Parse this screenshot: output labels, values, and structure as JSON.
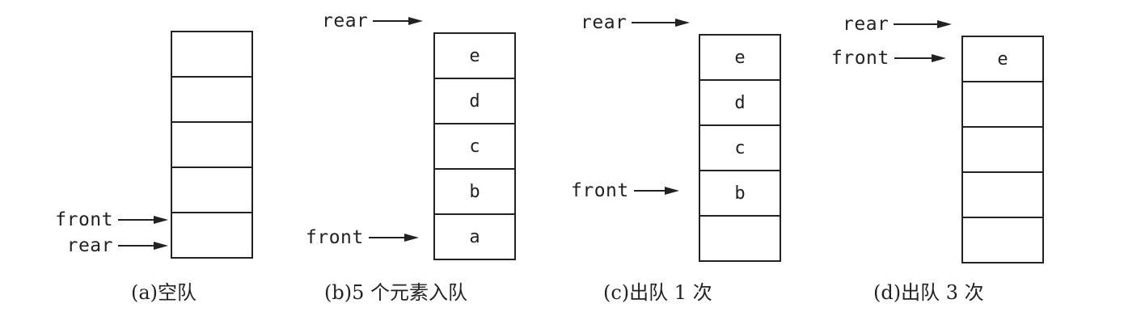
{
  "panels": [
    {
      "caption": "(a)空队",
      "cells": [
        "",
        "",
        "",
        "",
        ""
      ],
      "pointers": [
        {
          "label": "front",
          "cell_index": 4,
          "offset": "upper"
        },
        {
          "label": "rear",
          "cell_index": 4,
          "offset": "lower"
        }
      ]
    },
    {
      "caption": "(b)5 个元素入队",
      "cells": [
        "e",
        "d",
        "c",
        "b",
        "a"
      ],
      "pointers": [
        {
          "label": "rear",
          "cell_index": -1,
          "offset": "above"
        },
        {
          "label": "front",
          "cell_index": 4,
          "offset": "center"
        }
      ]
    },
    {
      "caption": "(c)出队 1 次",
      "cells": [
        "e",
        "d",
        "c",
        "b",
        ""
      ],
      "pointers": [
        {
          "label": "rear",
          "cell_index": -1,
          "offset": "above"
        },
        {
          "label": "front",
          "cell_index": 3,
          "offset": "center"
        }
      ]
    },
    {
      "caption": "(d)出队 3 次",
      "cells": [
        "e",
        "",
        "",
        "",
        ""
      ],
      "pointers": [
        {
          "label": "rear",
          "cell_index": -1,
          "offset": "above"
        },
        {
          "label": "front",
          "cell_index": 0,
          "offset": "center"
        }
      ]
    }
  ]
}
